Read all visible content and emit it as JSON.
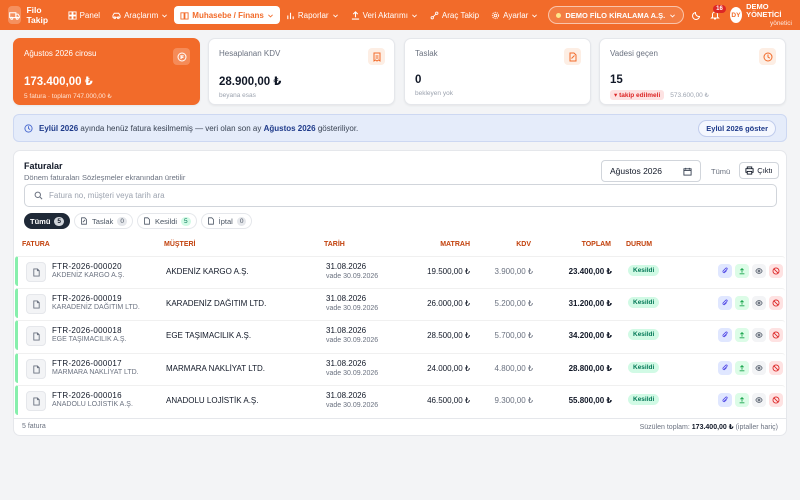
{
  "nav": {
    "brand": "Filo Takip",
    "items": [
      {
        "label": "Panel",
        "icon": "grid-icon"
      },
      {
        "label": "Araçlarım",
        "icon": "car-icon",
        "dropdown": true
      },
      {
        "label": "Muhasebe / Finans",
        "icon": "book-icon",
        "dropdown": true,
        "active": true
      },
      {
        "label": "Raporlar",
        "icon": "bar-chart-icon",
        "dropdown": true
      },
      {
        "label": "Veri Aktarımı",
        "icon": "upload-icon",
        "dropdown": true
      },
      {
        "label": "Araç Takip",
        "icon": "route-icon"
      },
      {
        "label": "Ayarlar",
        "icon": "gear-icon",
        "dropdown": true
      }
    ],
    "company": "DEMO FİLO KİRALAMA A.Ş.",
    "notification_count": "16",
    "avatar_initials": "DY",
    "user_name": "DEMO YÖNETİCİ",
    "user_role": "yönetici"
  },
  "cards": {
    "revenue": {
      "title": "Ağustos 2026 cirosu",
      "value": "173.400,00 ₺",
      "sub": "5 fatura · toplam 747.000,00 ₺"
    },
    "vat": {
      "title": "Hesaplanan KDV",
      "value": "28.900,00 ₺",
      "sub": "beyana esas"
    },
    "draft": {
      "title": "Taslak",
      "value": "0",
      "sub": "bekleyen yok"
    },
    "overdue": {
      "title": "Vadesi geçen",
      "value": "15",
      "tag": "takip edilmeli",
      "sub": "573.600,00 ₺"
    }
  },
  "banner": {
    "month_bold": "Eylül 2026",
    "text_mid": " ayında henüz fatura kesilmemiş — veri olan son ay ",
    "last_bold": "Ağustos 2026",
    "text_end": " gösteriliyor.",
    "button": "Eylül 2026 göster"
  },
  "invoices": {
    "title": "Faturalar",
    "subtitle": "Dönem faturaları Sözleşmeler ekranından üretilir",
    "month_value": "Ağustos 2026",
    "all_label": "Tümü",
    "print_label": "Çıktı",
    "search_placeholder": "Fatura no, müşteri veya tarih ara",
    "filters": [
      {
        "label": "Tümü",
        "count": "5",
        "active": true
      },
      {
        "label": "Taslak",
        "count": "0"
      },
      {
        "label": "Kesildi",
        "count": "5",
        "green": true
      },
      {
        "label": "İptal",
        "count": "0"
      }
    ],
    "columns": {
      "invoice": "FATURA",
      "customer": "MÜŞTERİ",
      "date": "TARİH",
      "base": "MATRAH",
      "vat": "KDV",
      "total": "TOPLAM",
      "status": "DURUM"
    },
    "rows": [
      {
        "no": "FTR-2026-000020",
        "cust_short": "AKDENİZ KARGO A.Ş.",
        "customer": "AKDENİZ KARGO A.Ş.",
        "date": "31.08.2026",
        "due": "vade 30.09.2026",
        "base": "19.500,00 ₺",
        "vat": "3.900,00 ₺",
        "total": "23.400,00 ₺",
        "status": "Kesildi"
      },
      {
        "no": "FTR-2026-000019",
        "cust_short": "KARADENİZ DAĞITIM LTD.",
        "customer": "KARADENİZ DAĞITIM LTD.",
        "date": "31.08.2026",
        "due": "vade 30.09.2026",
        "base": "26.000,00 ₺",
        "vat": "5.200,00 ₺",
        "total": "31.200,00 ₺",
        "status": "Kesildi"
      },
      {
        "no": "FTR-2026-000018",
        "cust_short": "EGE TAŞIMACILIK A.Ş.",
        "customer": "EGE TAŞIMACILIK A.Ş.",
        "date": "31.08.2026",
        "due": "vade 30.09.2026",
        "base": "28.500,00 ₺",
        "vat": "5.700,00 ₺",
        "total": "34.200,00 ₺",
        "status": "Kesildi"
      },
      {
        "no": "FTR-2026-000017",
        "cust_short": "MARMARA NAKLİYAT LTD.",
        "customer": "MARMARA NAKLİYAT LTD.",
        "date": "31.08.2026",
        "due": "vade 30.09.2026",
        "base": "24.000,00 ₺",
        "vat": "4.800,00 ₺",
        "total": "28.800,00 ₺",
        "status": "Kesildi"
      },
      {
        "no": "FTR-2026-000016",
        "cust_short": "ANADOLU LOJİSTİK A.Ş.",
        "customer": "ANADOLU LOJİSTİK A.Ş.",
        "date": "31.08.2026",
        "due": "vade 30.09.2026",
        "base": "46.500,00 ₺",
        "vat": "9.300,00 ₺",
        "total": "55.800,00 ₺",
        "status": "Kesildi"
      }
    ],
    "footer_count": "5 fatura",
    "footer_total_label": "Süzülen toplam:",
    "footer_total_value": "173.400,00 ₺",
    "footer_total_note": "(iptaller hariç)"
  },
  "colors": {
    "brand": "#f26b2a",
    "success": "#047857",
    "danger": "#dc2626"
  }
}
